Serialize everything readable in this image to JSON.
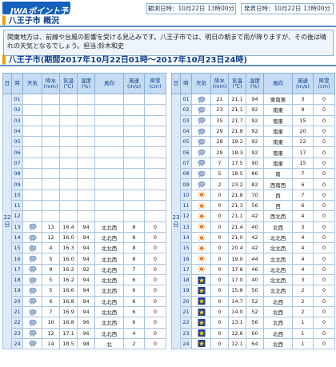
{
  "header": {
    "logo_text": "JWAポイント予測",
    "observed_label": "観測日時：10月22日 13時00分",
    "published_label": "発表日時：10月22日 13時00分"
  },
  "summary": {
    "title": "八王子市 概況",
    "text": "関東地方は、前線や台風の影響を受ける見込みです。八王子市では、明日の朝まで雨が降りますが、その後は晴れの天気となるでしょう。担当:鈴木和史"
  },
  "forecast": {
    "title": "八王子市(期間2017年10月22日01時～2017年10月23日24時)",
    "headers": [
      "日",
      "時",
      "天気",
      "降水 (mm)",
      "気温 (℃)",
      "湿度 (%)",
      "風向",
      "風速 (m/s)",
      "降雪 (cm)"
    ],
    "day1": {
      "label": "22日",
      "rows": [
        {
          "h": "01",
          "w": "",
          "p": "",
          "t": "",
          "hu": "",
          "wd": "",
          "ws": "",
          "s": ""
        },
        {
          "h": "02",
          "w": "",
          "p": "",
          "t": "",
          "hu": "",
          "wd": "",
          "ws": "",
          "s": ""
        },
        {
          "h": "03",
          "w": "",
          "p": "",
          "t": "",
          "hu": "",
          "wd": "",
          "ws": "",
          "s": ""
        },
        {
          "h": "04",
          "w": "",
          "p": "",
          "t": "",
          "hu": "",
          "wd": "",
          "ws": "",
          "s": ""
        },
        {
          "h": "05",
          "w": "",
          "p": "",
          "t": "",
          "hu": "",
          "wd": "",
          "ws": "",
          "s": ""
        },
        {
          "h": "06",
          "w": "",
          "p": "",
          "t": "",
          "hu": "",
          "wd": "",
          "ws": "",
          "s": ""
        },
        {
          "h": "07",
          "w": "",
          "p": "",
          "t": "",
          "hu": "",
          "wd": "",
          "ws": "",
          "s": ""
        },
        {
          "h": "08",
          "w": "",
          "p": "",
          "t": "",
          "hu": "",
          "wd": "",
          "ws": "",
          "s": ""
        },
        {
          "h": "09",
          "w": "",
          "p": "",
          "t": "",
          "hu": "",
          "wd": "",
          "ws": "",
          "s": ""
        },
        {
          "h": "10",
          "w": "",
          "p": "",
          "t": "",
          "hu": "",
          "wd": "",
          "ws": "",
          "s": ""
        },
        {
          "h": "11",
          "w": "",
          "p": "",
          "t": "",
          "hu": "",
          "wd": "",
          "ws": "",
          "s": ""
        },
        {
          "h": "12",
          "w": "",
          "p": "",
          "t": "",
          "hu": "",
          "wd": "",
          "ws": "",
          "s": ""
        },
        {
          "h": "13",
          "w": "rain-icon",
          "p": "13",
          "t": "16.4",
          "hu": "94",
          "wd": "北北西",
          "ws": "8",
          "s": "0"
        },
        {
          "h": "14",
          "w": "rain-icon",
          "p": "12",
          "t": "16.0",
          "hu": "94",
          "wd": "北北西",
          "ws": "8",
          "s": "0"
        },
        {
          "h": "15",
          "w": "rain-icon",
          "p": "4",
          "t": "16.3",
          "hu": "94",
          "wd": "北北西",
          "ws": "8",
          "s": "0"
        },
        {
          "h": "16",
          "w": "rain-icon",
          "p": "5",
          "t": "16.0",
          "hu": "94",
          "wd": "北北西",
          "ws": "8",
          "s": "0"
        },
        {
          "h": "17",
          "w": "rain-icon",
          "p": "9",
          "t": "16.2",
          "hu": "92",
          "wd": "北北西",
          "ws": "7",
          "s": "0"
        },
        {
          "h": "18",
          "w": "rain-icon",
          "p": "5",
          "t": "16.2",
          "hu": "94",
          "wd": "北北西",
          "ws": "6",
          "s": "0"
        },
        {
          "h": "19",
          "w": "rain-icon",
          "p": "5",
          "t": "16.6",
          "hu": "94",
          "wd": "北北西",
          "ws": "6",
          "s": "0"
        },
        {
          "h": "20",
          "w": "rain-icon",
          "p": "6",
          "t": "16.8",
          "hu": "94",
          "wd": "北北西",
          "ws": "6",
          "s": "0"
        },
        {
          "h": "21",
          "w": "rain-icon",
          "p": "7",
          "t": "16.9",
          "hu": "94",
          "wd": "北北西",
          "ws": "6",
          "s": "0"
        },
        {
          "h": "22",
          "w": "rain-icon",
          "p": "10",
          "t": "16.8",
          "hu": "96",
          "wd": "北北西",
          "ws": "6",
          "s": "0"
        },
        {
          "h": "23",
          "w": "rain-icon",
          "p": "12",
          "t": "17.1",
          "hu": "96",
          "wd": "北北西",
          "ws": "4",
          "s": "0"
        },
        {
          "h": "24",
          "w": "rain-icon",
          "p": "14",
          "t": "18.5",
          "hu": "98",
          "wd": "北",
          "ws": "2",
          "s": "0"
        }
      ]
    },
    "day2": {
      "label": "23日",
      "rows": [
        {
          "h": "01",
          "w": "rain-icon",
          "p": "21",
          "t": "21.1",
          "hu": "94",
          "wd": "東南東",
          "ws": "3",
          "s": "0"
        },
        {
          "h": "02",
          "w": "rain-icon",
          "p": "23",
          "t": "21.1",
          "hu": "92",
          "wd": "南東",
          "ws": "9",
          "s": "0"
        },
        {
          "h": "03",
          "w": "rain-icon",
          "p": "35",
          "t": "21.7",
          "hu": "92",
          "wd": "南東",
          "ws": "15",
          "s": "0"
        },
        {
          "h": "04",
          "w": "rain-icon",
          "p": "29",
          "t": "21.8",
          "hu": "92",
          "wd": "南東",
          "ws": "20",
          "s": "0"
        },
        {
          "h": "05",
          "w": "rain-icon",
          "p": "28",
          "t": "19.2",
          "hu": "92",
          "wd": "南東",
          "ws": "22",
          "s": "0"
        },
        {
          "h": "06",
          "w": "rain-icon",
          "p": "29",
          "t": "18.3",
          "hu": "92",
          "wd": "南東",
          "ws": "17",
          "s": "0"
        },
        {
          "h": "07",
          "w": "rain-icon",
          "p": "7",
          "t": "17.5",
          "hu": "90",
          "wd": "南東",
          "ws": "15",
          "s": "0"
        },
        {
          "h": "08",
          "w": "rain-icon",
          "p": "5",
          "t": "18.5",
          "hu": "86",
          "wd": "南",
          "ws": "7",
          "s": "0"
        },
        {
          "h": "09",
          "w": "rain-icon",
          "p": "2",
          "t": "23.2",
          "hu": "82",
          "wd": "西南西",
          "ws": "6",
          "s": "0"
        },
        {
          "h": "10",
          "w": "sun-icon",
          "p": "0",
          "t": "21.8",
          "hu": "70",
          "wd": "西",
          "ws": "7",
          "s": "0"
        },
        {
          "h": "11",
          "w": "sun-icon",
          "p": "0",
          "t": "21.3",
          "hu": "56",
          "wd": "西",
          "ws": "6",
          "s": "0"
        },
        {
          "h": "12",
          "w": "sun-icon",
          "p": "0",
          "t": "21.1",
          "hu": "42",
          "wd": "西北西",
          "ws": "4",
          "s": "0"
        },
        {
          "h": "13",
          "w": "sun-icon",
          "p": "0",
          "t": "21.4",
          "hu": "40",
          "wd": "北西",
          "ws": "3",
          "s": "0"
        },
        {
          "h": "14",
          "w": "sun-icon",
          "p": "0",
          "t": "21.0",
          "hu": "42",
          "wd": "北北西",
          "ws": "4",
          "s": "0"
        },
        {
          "h": "15",
          "w": "sun-icon",
          "p": "0",
          "t": "20.4",
          "hu": "42",
          "wd": "北北西",
          "ws": "4",
          "s": "0"
        },
        {
          "h": "16",
          "w": "sun-icon",
          "p": "0",
          "t": "19.0",
          "hu": "44",
          "wd": "北北西",
          "ws": "4",
          "s": "0"
        },
        {
          "h": "17",
          "w": "sun-icon",
          "p": "0",
          "t": "17.8",
          "hu": "46",
          "wd": "北北西",
          "ws": "4",
          "s": "0"
        },
        {
          "h": "18",
          "w": "moon-icon",
          "p": "0",
          "t": "17.0",
          "hu": "40",
          "wd": "北北西",
          "ws": "3",
          "s": "0"
        },
        {
          "h": "19",
          "w": "moon-icon",
          "p": "0",
          "t": "15.8",
          "hu": "50",
          "wd": "北北西",
          "ws": "2",
          "s": "0"
        },
        {
          "h": "20",
          "w": "moon-icon",
          "p": "0",
          "t": "14.7",
          "hu": "52",
          "wd": "北西",
          "ws": "2",
          "s": "0"
        },
        {
          "h": "21",
          "w": "moon-icon",
          "p": "0",
          "t": "14.0",
          "hu": "52",
          "wd": "北西",
          "ws": "2",
          "s": "0"
        },
        {
          "h": "22",
          "w": "moon-icon",
          "p": "0",
          "t": "13.1",
          "hu": "56",
          "wd": "北西",
          "ws": "1",
          "s": "0"
        },
        {
          "h": "23",
          "w": "moon-icon",
          "p": "0",
          "t": "12.6",
          "hu": "60",
          "wd": "北西",
          "ws": "1",
          "s": "0"
        },
        {
          "h": "24",
          "w": "moon-icon",
          "p": "0",
          "t": "12.1",
          "hu": "64",
          "wd": "北西",
          "ws": "1",
          "s": "0"
        }
      ]
    }
  }
}
